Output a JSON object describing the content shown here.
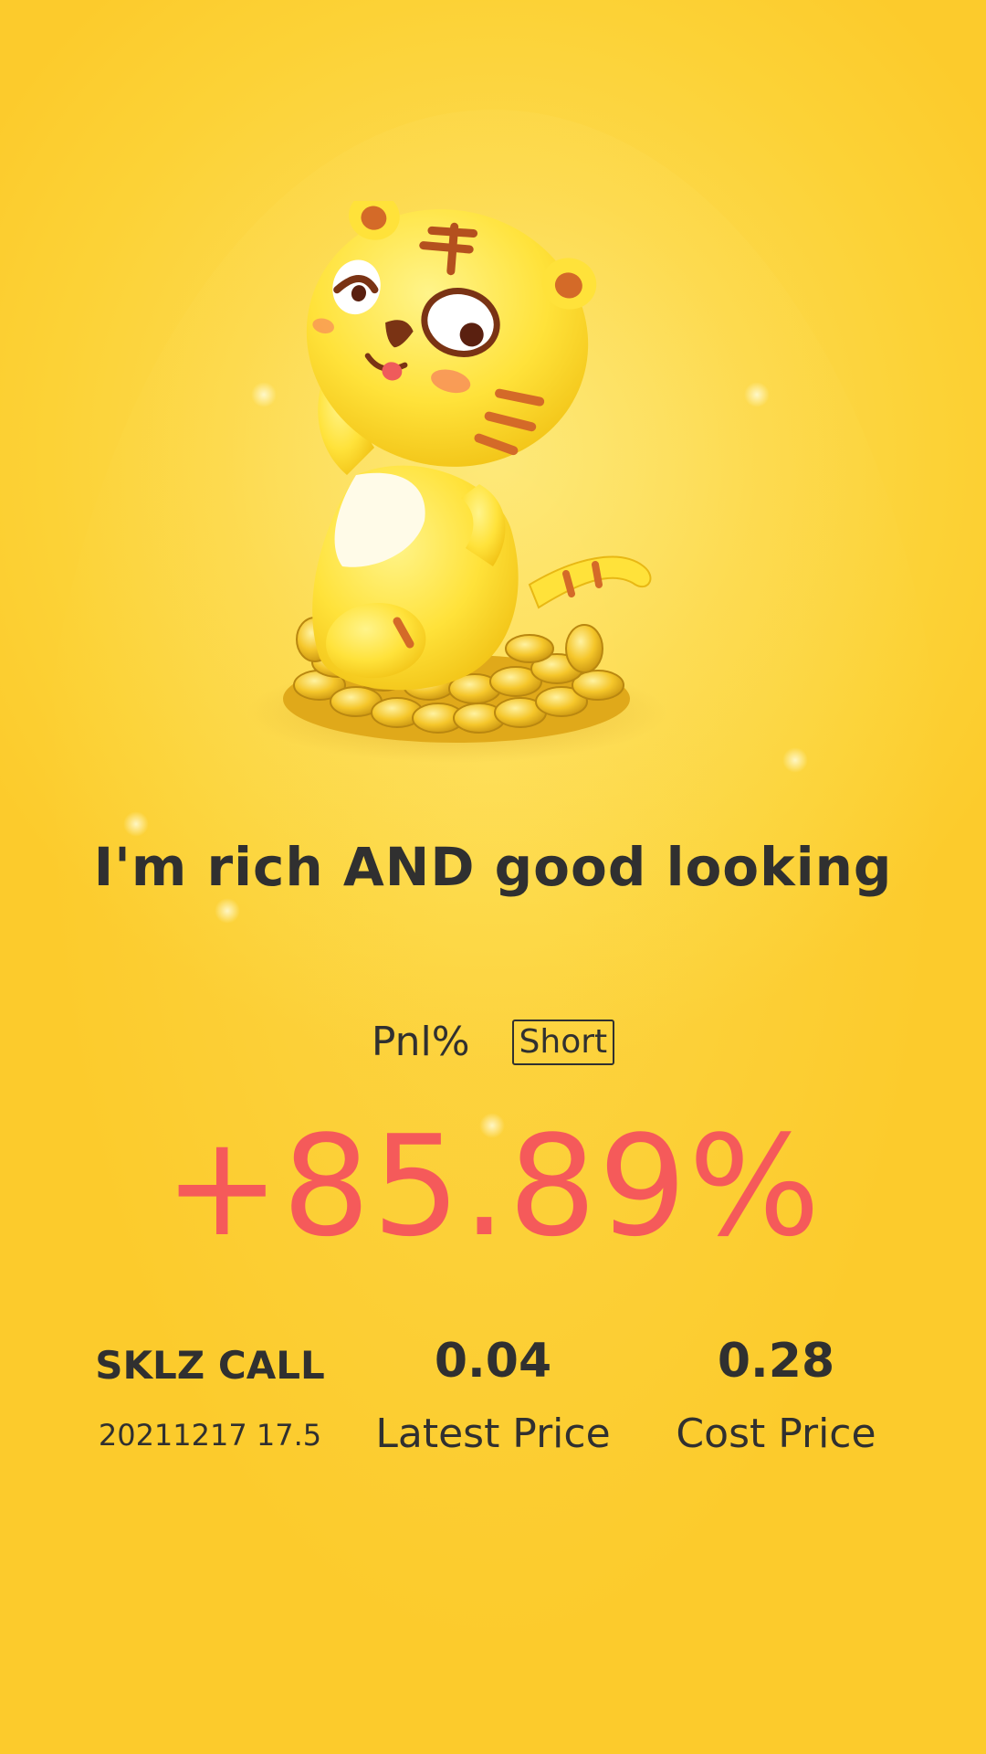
{
  "headline": "I'm rich AND good looking",
  "pnl": {
    "label": "Pnl%",
    "direction_badge": "Short",
    "value": "+85.89%"
  },
  "position": {
    "contract": "SKLZ CALL",
    "detail": "20211217 17.5"
  },
  "latest_price": {
    "value": "0.04",
    "label": "Latest Price"
  },
  "cost_price": {
    "value": "0.28",
    "label": "Cost Price"
  },
  "colors": {
    "background": "#fcd236",
    "gain": "#f55a5a",
    "text": "#303030"
  },
  "illustration": "tiger-mascot-on-gold-coins-icon"
}
